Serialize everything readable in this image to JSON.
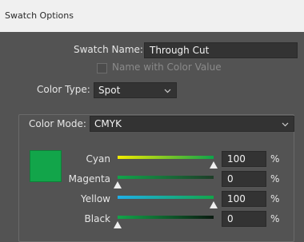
{
  "window": {
    "title": "Swatch Options"
  },
  "swatch_name": {
    "label": "Swatch Name:",
    "value": "Through Cut"
  },
  "name_with_color_value": {
    "label": "Name with Color Value",
    "checked": false,
    "disabled": true
  },
  "color_type": {
    "label": "Color Type:",
    "value": "Spot"
  },
  "color_mode": {
    "label": "Color Mode:",
    "value": "CMYK"
  },
  "swatch_color": "#12a54a",
  "channels": [
    {
      "label": "Cyan",
      "value": "100",
      "unit": "%",
      "level": 1.0
    },
    {
      "label": "Magenta",
      "value": "0",
      "unit": "%",
      "level": 0.0
    },
    {
      "label": "Yellow",
      "value": "100",
      "unit": "%",
      "level": 1.0
    },
    {
      "label": "Black",
      "value": "0",
      "unit": "%",
      "level": 0.0
    }
  ],
  "icons": {
    "dropdown": "chevron-down-icon",
    "slider_thumb": "triangle-up-icon"
  }
}
